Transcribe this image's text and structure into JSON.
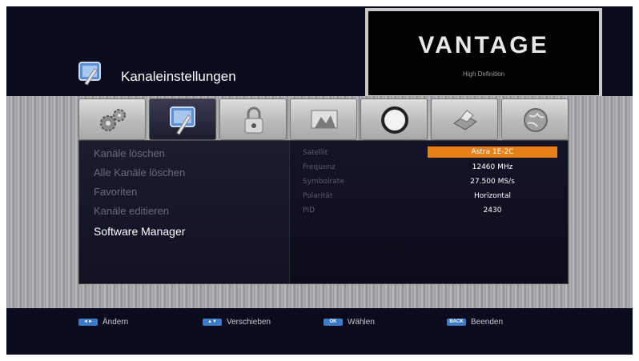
{
  "header": {
    "title": "Kanaleinstellungen",
    "icon": "settings-tools-icon"
  },
  "preview": {
    "brand": "VANTAGE",
    "subtitle": "High Definition"
  },
  "tabs": [
    {
      "icon": "gears-icon",
      "active": false
    },
    {
      "icon": "channel-settings-icon",
      "active": true
    },
    {
      "icon": "lock-icon",
      "active": false
    },
    {
      "icon": "satellite-dish-icon",
      "active": false
    },
    {
      "icon": "disc-icon",
      "active": false
    },
    {
      "icon": "printer-icon",
      "active": false
    },
    {
      "icon": "globe-icon",
      "active": false
    }
  ],
  "menu": {
    "items": [
      {
        "label": "Kanäle löschen"
      },
      {
        "label": "Alle Kanäle löschen"
      },
      {
        "label": "Favoriten"
      },
      {
        "label": "Kanäle editieren"
      },
      {
        "label": "Software Manager",
        "selected": true
      }
    ]
  },
  "info": {
    "rows": [
      {
        "label": "Satellit",
        "value": "Astra 1E-2C",
        "highlight": true
      },
      {
        "label": "Frequenz",
        "value": "12460 MHz"
      },
      {
        "label": "Symbolrate",
        "value": "27.500 MS/s"
      },
      {
        "label": "Polarität",
        "value": "Horizontal"
      },
      {
        "label": "PID",
        "value": "2430"
      }
    ]
  },
  "footer": {
    "hints": [
      {
        "key": "◄►",
        "label": "Ändern"
      },
      {
        "key": "▲▼",
        "label": "Verschieben"
      },
      {
        "key": "OK",
        "label": "Wählen"
      },
      {
        "key": "BACK",
        "label": "Beenden"
      }
    ]
  },
  "colors": {
    "accent": "#e8801a",
    "key_blue": "#3b7bc8",
    "background": "#0a0a18"
  }
}
